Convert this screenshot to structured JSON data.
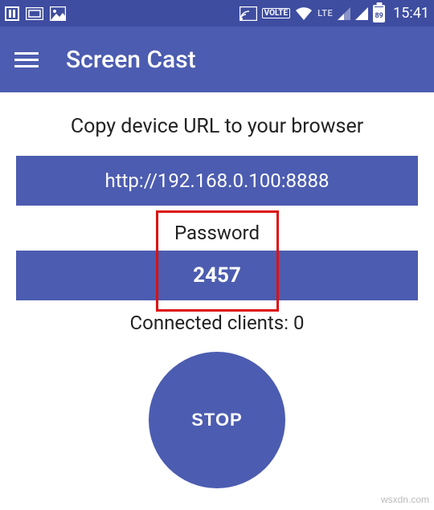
{
  "status_bar": {
    "battery_percent": "89",
    "clock": "15:41",
    "network_label": "LTE",
    "volte_label": "VOLTE"
  },
  "app_bar": {
    "title": "Screen Cast"
  },
  "main": {
    "instruction": "Copy device URL to your browser",
    "url": "http://192.168.0.100:8888",
    "password_label": "Password",
    "password_value": "2457",
    "connected_clients_label": "Connected clients: 0",
    "stop_label": "STOP"
  },
  "watermark": "wsxdn.com"
}
